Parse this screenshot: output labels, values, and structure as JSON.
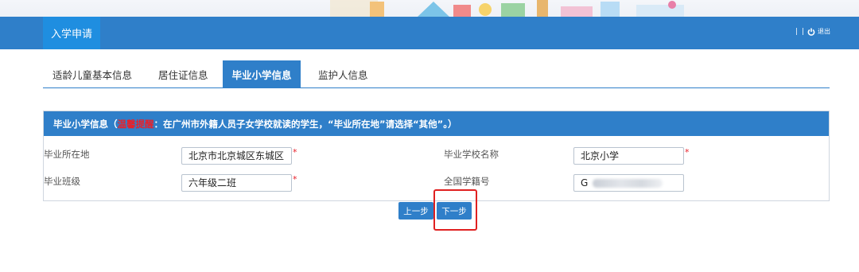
{
  "nav": {
    "tab_label": "入学申请",
    "separator": "| |",
    "logout_label": "退出"
  },
  "tabs": [
    {
      "label": "适龄儿童基本信息",
      "active": false
    },
    {
      "label": "居住证信息",
      "active": false
    },
    {
      "label": "毕业小学信息",
      "active": true
    },
    {
      "label": "监护人信息",
      "active": false
    }
  ],
  "panel": {
    "title_prefix": "毕业小学信息（",
    "warning_label": "温馨提醒",
    "title_suffix": "：在广州市外籍人员子女学校就读的学生，“毕业所在地”请选择“其他”。）"
  },
  "fields": {
    "grad_location": {
      "label": "毕业所在地",
      "value": "北京市北京城区东城区",
      "required": true
    },
    "school_name": {
      "label": "毕业学校名称",
      "value": "北京小学",
      "required": true
    },
    "grad_class": {
      "label": "毕业班级",
      "value": "六年级二班",
      "required": true
    },
    "student_id": {
      "label": "全国学籍号",
      "value": "G",
      "required": false
    }
  },
  "required_mark": "*",
  "buttons": {
    "prev": "上一步",
    "next": "下一步"
  },
  "colors": {
    "primary": "#2f7fc9",
    "active_nav": "#1f8ee0",
    "warning": "#e8202a",
    "highlight": "#e02020"
  },
  "icons": {
    "logout": "power-icon"
  }
}
